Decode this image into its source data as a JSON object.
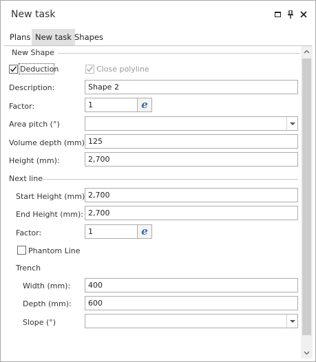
{
  "window": {
    "title": "New task",
    "buttons": [
      "maximize",
      "pin",
      "close"
    ]
  },
  "tabs": [
    {
      "label": "Plans",
      "active": false
    },
    {
      "label": "New task",
      "active": true
    },
    {
      "label": "Shapes",
      "active": false
    }
  ],
  "new_shape": {
    "group_label": "New Shape",
    "deduction": {
      "label": "Deduction",
      "checked": true
    },
    "close_polyline": {
      "label": "Close polyline",
      "checked": true,
      "enabled": false
    },
    "description": {
      "label": "Description:",
      "value": "Shape 2"
    },
    "factor": {
      "label": "Factor:",
      "value": "1",
      "button": "e"
    },
    "area_pitch": {
      "label": "Area pitch (°)",
      "value": ""
    },
    "volume_depth": {
      "label": "Volume depth (mm):",
      "value": "125"
    },
    "height": {
      "label": "Height (mm):",
      "value": "2,700"
    }
  },
  "next_line": {
    "group_label": "Next line",
    "start_height": {
      "label": "Start Height (mm):",
      "value": "2,700"
    },
    "end_height": {
      "label": "End Height (mm):",
      "value": "2,700"
    },
    "factor": {
      "label": "Factor:",
      "value": "1",
      "button": "e"
    },
    "phantom_line": {
      "label": "Phantom Line",
      "checked": false
    }
  },
  "trench": {
    "group_label": "Trench",
    "width": {
      "label": "Width (mm):",
      "value": "400"
    },
    "depth": {
      "label": "Depth (mm):",
      "value": "600"
    },
    "slope": {
      "label": "Slope (°)",
      "value": ""
    }
  },
  "icons": {
    "maximize": "maximize-icon",
    "pin": "pin-icon",
    "close": "close-icon",
    "check": "check-icon",
    "dropdown": "chevron-down-icon",
    "scroll_up": "chevron-up-icon",
    "scroll_down": "chevron-down-icon"
  }
}
